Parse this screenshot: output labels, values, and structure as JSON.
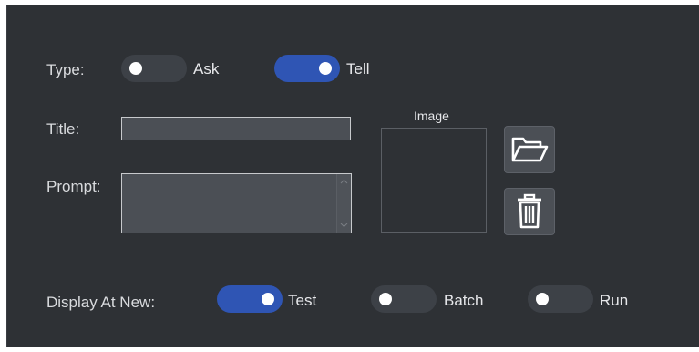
{
  "type": {
    "label": "Type:",
    "options": [
      {
        "label": "Ask",
        "on": false
      },
      {
        "label": "Tell",
        "on": true
      }
    ]
  },
  "title": {
    "label": "Title:",
    "value": ""
  },
  "prompt": {
    "label": "Prompt:",
    "value": ""
  },
  "image": {
    "label": "Image",
    "open_icon": "folder-open-icon",
    "delete_icon": "trash-icon"
  },
  "display_at_new": {
    "label": "Display At New:",
    "options": [
      {
        "label": "Test",
        "on": true
      },
      {
        "label": "Batch",
        "on": false
      },
      {
        "label": "Run",
        "on": false
      }
    ]
  },
  "colors": {
    "background": "#2e3135",
    "toggle_on": "#2f55b4",
    "toggle_off": "#3d4147",
    "field": "#4b4f55"
  }
}
